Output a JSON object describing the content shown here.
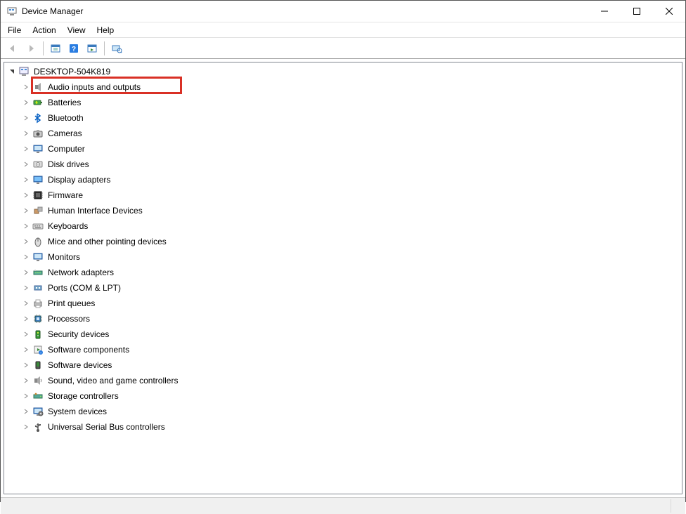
{
  "window": {
    "title": "Device Manager"
  },
  "menubar": {
    "items": [
      "File",
      "Action",
      "View",
      "Help"
    ]
  },
  "toolbar": {
    "buttons": [
      {
        "name": "back",
        "disabled": true
      },
      {
        "name": "forward",
        "disabled": true
      },
      {
        "name": "show-hidden",
        "disabled": false
      },
      {
        "name": "help",
        "disabled": false
      },
      {
        "name": "action-2",
        "disabled": false
      },
      {
        "name": "scan",
        "disabled": false
      }
    ]
  },
  "tree": {
    "root": {
      "label": "DESKTOP-504K819",
      "expanded": true
    },
    "categories": [
      {
        "label": "Audio inputs and outputs",
        "icon": "audio",
        "highlighted": true
      },
      {
        "label": "Batteries",
        "icon": "battery"
      },
      {
        "label": "Bluetooth",
        "icon": "bluetooth"
      },
      {
        "label": "Cameras",
        "icon": "camera"
      },
      {
        "label": "Computer",
        "icon": "computer"
      },
      {
        "label": "Disk drives",
        "icon": "disk"
      },
      {
        "label": "Display adapters",
        "icon": "display"
      },
      {
        "label": "Firmware",
        "icon": "firmware"
      },
      {
        "label": "Human Interface Devices",
        "icon": "hid"
      },
      {
        "label": "Keyboards",
        "icon": "keyboard"
      },
      {
        "label": "Mice and other pointing devices",
        "icon": "mouse"
      },
      {
        "label": "Monitors",
        "icon": "monitor"
      },
      {
        "label": "Network adapters",
        "icon": "network"
      },
      {
        "label": "Ports (COM & LPT)",
        "icon": "port"
      },
      {
        "label": "Print queues",
        "icon": "printer"
      },
      {
        "label": "Processors",
        "icon": "processor"
      },
      {
        "label": "Security devices",
        "icon": "security"
      },
      {
        "label": "Software components",
        "icon": "software-comp"
      },
      {
        "label": "Software devices",
        "icon": "software-dev"
      },
      {
        "label": "Sound, video and game controllers",
        "icon": "sound"
      },
      {
        "label": "Storage controllers",
        "icon": "storage"
      },
      {
        "label": "System devices",
        "icon": "system"
      },
      {
        "label": "Universal Serial Bus controllers",
        "icon": "usb"
      }
    ]
  }
}
